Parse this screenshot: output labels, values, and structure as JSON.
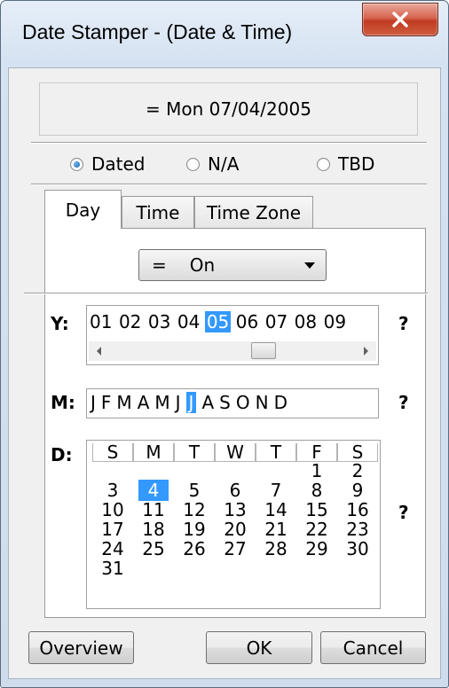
{
  "window": {
    "title": "Date Stamper - (Date & Time)",
    "close_icon": "close-x-icon"
  },
  "display": {
    "value": "= Mon 07/04/2005"
  },
  "status_options": [
    {
      "label": "Dated",
      "selected": true
    },
    {
      "label": "N/A",
      "selected": false
    },
    {
      "label": "TBD",
      "selected": false
    }
  ],
  "tabs": [
    {
      "label": "Day",
      "active": true
    },
    {
      "label": "Time",
      "active": false
    },
    {
      "label": "Time Zone",
      "active": false
    }
  ],
  "day_tab": {
    "comparison": {
      "operator": "=",
      "value": "On"
    },
    "year": {
      "label": "Y:",
      "items": [
        "01",
        "02",
        "03",
        "04",
        "05",
        "06",
        "07",
        "08",
        "09"
      ],
      "selected": "05",
      "help": "?"
    },
    "month": {
      "label": "M:",
      "items": [
        "J",
        "F",
        "M",
        "A",
        "M",
        "J",
        "J",
        "A",
        "S",
        "O",
        "N",
        "D"
      ],
      "selected_index": 6,
      "help": "?"
    },
    "day": {
      "label": "D:",
      "weekdays": [
        "S",
        "M",
        "T",
        "W",
        "T",
        "F",
        "S"
      ],
      "weeks": [
        [
          "",
          "",
          "",
          "",
          "",
          "1",
          "2"
        ],
        [
          "3",
          "4",
          "5",
          "6",
          "7",
          "8",
          "9"
        ],
        [
          "10",
          "11",
          "12",
          "13",
          "14",
          "15",
          "16"
        ],
        [
          "17",
          "18",
          "19",
          "20",
          "21",
          "22",
          "23"
        ],
        [
          "24",
          "25",
          "26",
          "27",
          "28",
          "29",
          "30"
        ],
        [
          "31",
          "",
          "",
          "",
          "",
          "",
          ""
        ]
      ],
      "selected": "4",
      "help": "?"
    }
  },
  "buttons": {
    "overview": "Overview",
    "ok": "OK",
    "cancel": "Cancel"
  },
  "colors": {
    "selection": "#3399ff",
    "close_button": "#c13b22"
  }
}
